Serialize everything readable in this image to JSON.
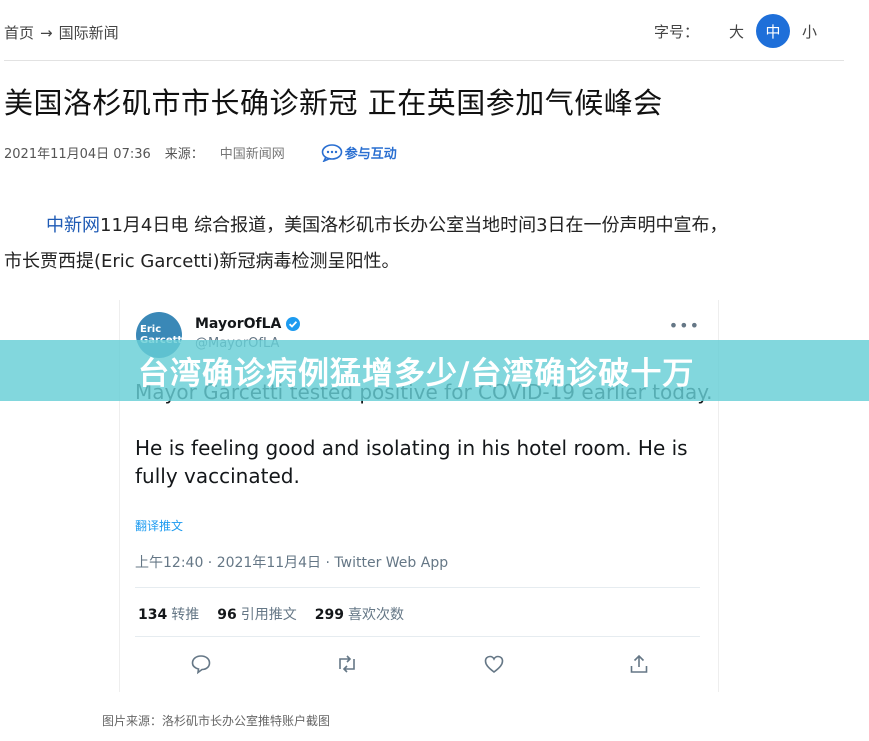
{
  "breadcrumb": {
    "home": "首页",
    "separator": "→",
    "section": "国际新闻"
  },
  "font_size_control": {
    "label": "字号：",
    "large": "大",
    "medium": "中",
    "small": "小",
    "active": "中",
    "active_color": "#1e6fd9"
  },
  "article": {
    "title": "美国洛杉矶市市长确诊新冠 正在英国参加气候峰会",
    "datetime": "2021年11月04日 07:36",
    "source_label": "来源：",
    "source": "中国新闻网",
    "interact_label": "参与互动",
    "lead_agency": "中新网",
    "lead_line1": "11月4日电 综合报道，美国洛杉矶市长办公室当地时间3日在一份声明中宣布，",
    "lead_line2": "市长贾西提(Eric Garcetti)新冠病毒检测呈阳性。",
    "agency_color": "#1f5bb5"
  },
  "tweet": {
    "avatar_line1": "Eric",
    "avatar_line2": "Garcetti",
    "display_name": "MayorOfLA",
    "handle": "@MayorOfLA",
    "text_p1": "Mayor Garcetti tested positive for COVID-19 earlier today.",
    "text_p2": "He is feeling good and isolating in his hotel room. He is fully vaccinated.",
    "translate": "翻译推文",
    "timestamp": "上午12:40 · 2021年11月4日 · Twitter Web App",
    "retweets_count": "134",
    "retweets_label": "转推",
    "quotes_count": "96",
    "quotes_label": "引用推文",
    "likes_count": "299",
    "likes_label": "喜欢次数",
    "icons": [
      "more-icon",
      "verified-icon",
      "reply-icon",
      "retweet-icon",
      "like-icon",
      "share-icon"
    ]
  },
  "overlay_banner": {
    "text": "台湾确诊病例猛增多少/台湾确诊破十万",
    "color": "#66ced6"
  },
  "caption": "图片来源：洛杉矶市长办公室推特账户截图"
}
